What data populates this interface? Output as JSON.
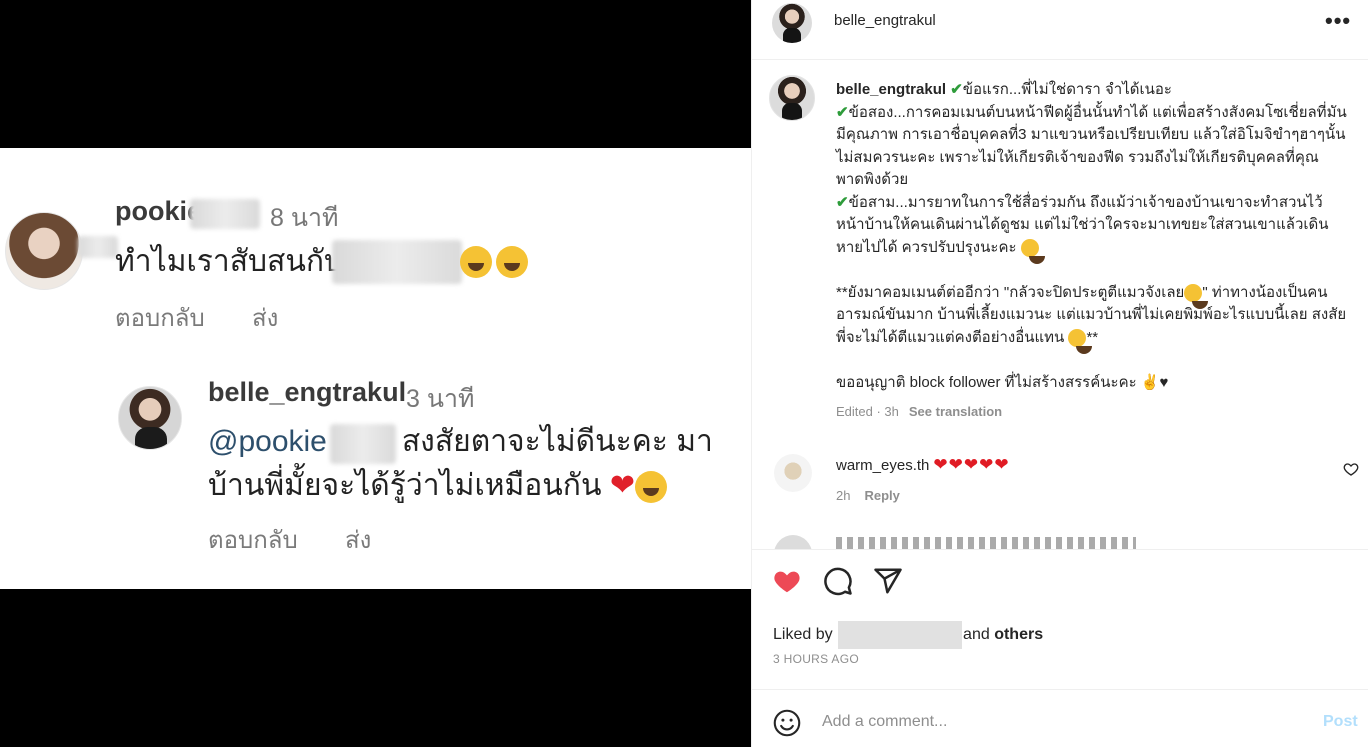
{
  "media": {
    "comment1": {
      "name": "pookie",
      "time": "8 นาที",
      "text": "ทำไมเราสับสนกับ",
      "reply": "ตอบกลับ",
      "send": "ส่ง"
    },
    "comment2": {
      "name": "belle_engtrakul",
      "time": "3 นาที",
      "mention": "@pookie",
      "text_line1": "สงสัยตาจะไม่ดีนะคะ มา",
      "text_line2": "บ้านพี่มั้ยจะได้รู้ว่าไม่เหมือนกัน",
      "reply": "ตอบกลับ",
      "send": "ส่ง"
    }
  },
  "header": {
    "username": "belle_engtrakul",
    "more_icon": "more-horizontal-icon"
  },
  "caption": {
    "username": "belle_engtrakul",
    "line1": "ข้อแรก...พี่ไม่ใช่ดารา จำได้เนอะ",
    "para2": "ข้อสอง...การคอมเมนต์บนหน้าฟีดผู้อื่นนั้นทำได้ แต่เพื่อสร้างสังคมโซเชี่ยลที่มันมีคุณภาพ การเอาชื่อบุคคลที่3 มาแขวนหรือเปรียบเทียบ แล้วใส่อิโมจิขำๆฮาๆนั้น ไม่สมควรนะคะ เพราะไม่ให้เกียรติเจ้าของฟีด รวมถึงไม่ให้เกียรติบุคคลที่คุณพาดพิงด้วย",
    "para3": "ข้อสาม...มารยาทในการใช้สื่อร่วมกัน ถึงแม้ว่าเจ้าของบ้านเขาจะทำสวนไว้หน้าบ้านให้คนเดินผ่านได้ดูชม แต่ไม่ใช่ว่าใครจะมาเทขยะใส่สวนเขาแล้วเดินหายไปได้ ควรปรับปรุงนะคะ",
    "para4a": "**ยังมาคอมเมนต์ต่ออีกว่า \"กลัวจะปิดประตูตีแมวจังเลย",
    "para4b": "\" ท่าทางน้องเป็นคนอารมณ์ขันมาก บ้านพี่เลี้ยงแมวนะ แต่แมวบ้านพี่ไม่เคยพิมพ์อะไรแบบนี้เลย สงสัยพี่จะไม่ได้ตีแมวแต่คงตีอย่างอื่นแทน",
    "para4c": "**",
    "para5": "ขออนุญาติ block follower ที่ไม่สร้างสรรค์นะคะ",
    "edited": "Edited · 3h",
    "see_translation": "See translation"
  },
  "comment": {
    "username": "warm_eyes.th",
    "hearts": "❤❤❤❤❤",
    "time": "2h",
    "reply": "Reply"
  },
  "actions": {
    "liked_prefix": "Liked by",
    "liked_and": "and",
    "liked_others": "others",
    "date": "3 HOURS AGO"
  },
  "add_comment": {
    "placeholder": "Add a comment...",
    "post": "Post"
  },
  "colors": {
    "like": "#ed4956",
    "link": "#2d4f6c",
    "post_disabled": "#b2dffc",
    "check": "#2e9c3b"
  }
}
